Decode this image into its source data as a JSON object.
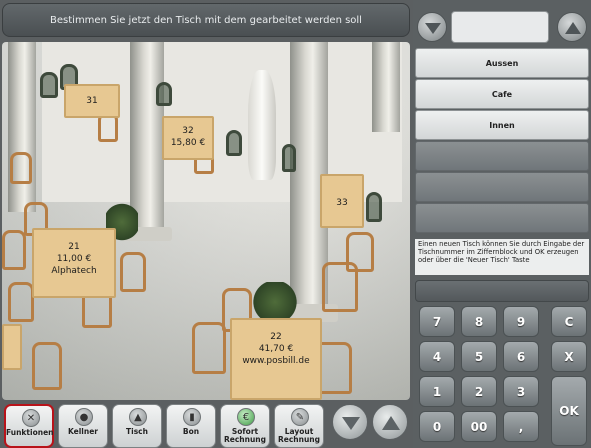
{
  "header": {
    "instruction": "Bestimmen Sie jetzt den Tisch mit dem gearbeitet werden soll"
  },
  "tables": [
    {
      "number": "31",
      "amount": "",
      "name": ""
    },
    {
      "number": "32",
      "amount": "15,80 €",
      "name": ""
    },
    {
      "number": "33",
      "amount": "",
      "name": ""
    },
    {
      "number": "21",
      "amount": "11,00 €",
      "name": "Alphatech"
    },
    {
      "number": "22",
      "amount": "41,70 €",
      "name": "www.posbill.de"
    }
  ],
  "toolbar": {
    "buttons": [
      {
        "label": "Funktionen",
        "icon": "tools-icon"
      },
      {
        "label": "Kellner",
        "icon": "waiter-icon"
      },
      {
        "label": "Tisch",
        "icon": "table-icon"
      },
      {
        "label": "Bon",
        "icon": "receipt-icon"
      },
      {
        "label": "Sofort Rechnung",
        "icon": "money-icon"
      },
      {
        "label": "Layout Rechnung",
        "icon": "layout-icon"
      }
    ],
    "scroll_down": "chevron-down-icon",
    "scroll_up": "chevron-up-icon"
  },
  "rooms": {
    "items": [
      "Aussen",
      "Cafe",
      "Innen"
    ]
  },
  "info_text": "Einen neuen Tisch können Sie durch Eingabe der Tischnummer im Ziffernblock und OK erzeugen oder über die 'Neuer Tisch' Taste",
  "keypad": {
    "keys": [
      "7",
      "8",
      "9",
      "C",
      "4",
      "5",
      "6",
      "X",
      "1",
      "2",
      "3",
      "0",
      "00",
      ","
    ],
    "ok": "OK"
  },
  "colors": {
    "active_border": "#b8131a",
    "panel_bg": "#5b6062"
  }
}
